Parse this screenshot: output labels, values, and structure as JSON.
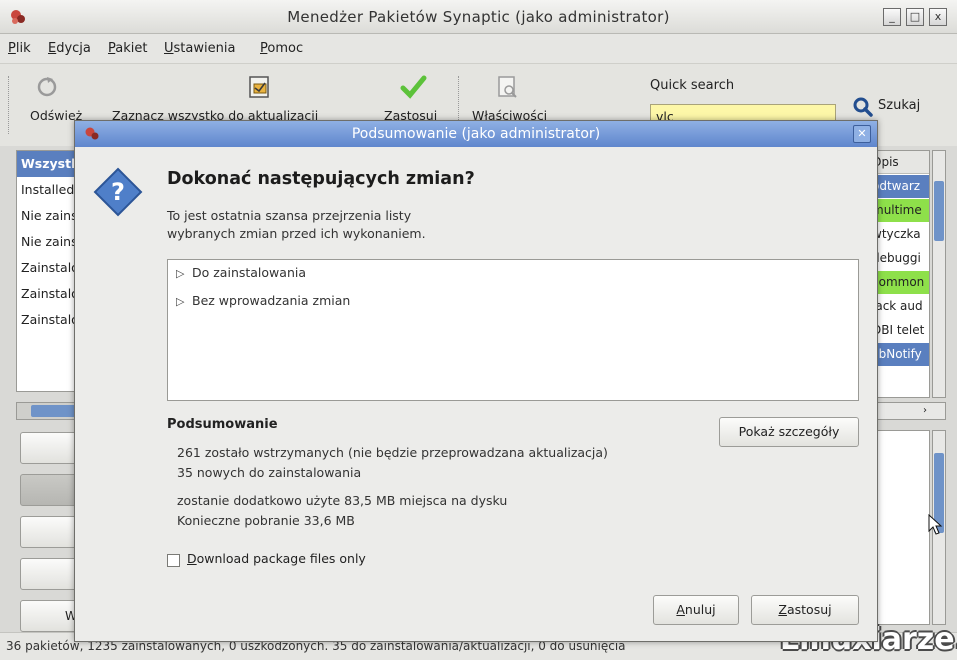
{
  "window": {
    "title": "Menedżer Pakietów Synaptic (jako administrator)",
    "controls": [
      "_",
      "□",
      "x"
    ]
  },
  "menu": [
    {
      "key": "P",
      "rest": "lik"
    },
    {
      "key": "E",
      "rest": "dycja"
    },
    {
      "key": "P",
      "rest": "akiet"
    },
    {
      "key": "U",
      "rest": "stawienia"
    },
    {
      "key": "P",
      "rest": "omoc"
    }
  ],
  "toolbar": {
    "reload_label": "Odśwież",
    "mark_all_label": "Zaznacz wszystko do aktualizacji",
    "apply_label": "Zastosuj",
    "properties_label": "Właściwości",
    "quick_search_label": "Quick search",
    "quick_search_value": "vlc",
    "search_label": "Szukaj"
  },
  "filters": {
    "items": [
      "Wszystkie",
      "Installed",
      "Nie zainstalowane",
      "Nie zainstalowane",
      "Zainstalowane",
      "Zainstalowane",
      "Zainstalowane"
    ]
  },
  "left_buttons": [
    "",
    "",
    "",
    "",
    "W"
  ],
  "right_list": {
    "header": "Opis",
    "rows": [
      "odtwarz",
      "multime",
      "wtyczka",
      "debuggi",
      "common",
      "jack aud",
      "DBI telet",
      "libNotify"
    ]
  },
  "status_bar": "36 pakietów, 1235 zainstalowanych, 0 uszkodzonych. 35 do zainstalowania/aktualizacji, 0 do usunięcia",
  "watermark": "Linuxiarze.pl",
  "dialog": {
    "title": "Podsumowanie (jako administrator)",
    "heading": "Dokonać następujących zmian?",
    "subtext_line1": "To jest ostatnia szansa przejrzenia listy",
    "subtext_line2": "wybranych zmian przed ich wykonaniem.",
    "changes": [
      "Do zainstalowania",
      "Bez wprowadzania zmian"
    ],
    "summary_title": "Podsumowanie",
    "summary_lines": [
      "261 zostało wstrzymanych (nie będzie przeprowadzana aktualizacja)",
      "35 nowych do zainstalowania",
      "zostanie dodatkowo użyte 83,5 MB miejsca na dysku",
      "Konieczne pobranie 33,6 MB"
    ],
    "details_button": "Pokaż szczegóły",
    "download_only_key": "D",
    "download_only_rest": "ownload package files only",
    "cancel_key": "A",
    "cancel_rest": "nuluj",
    "apply_key": "Z",
    "apply_rest": "astosuj"
  }
}
